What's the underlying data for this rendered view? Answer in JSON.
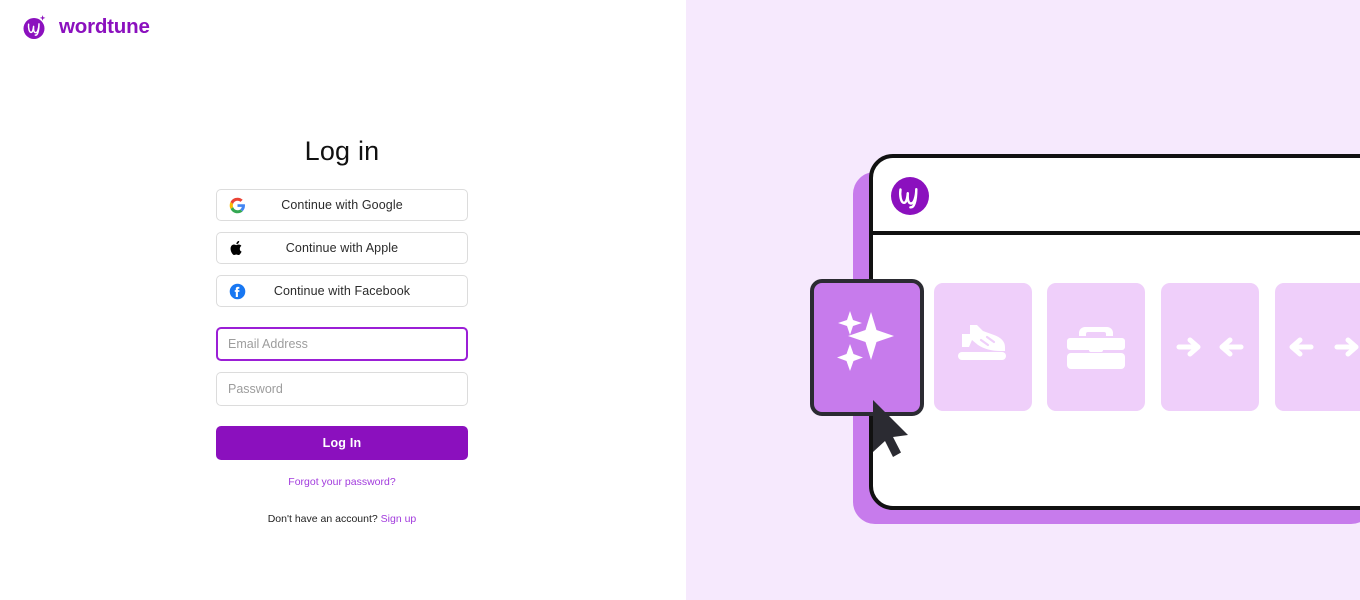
{
  "brand": {
    "name": "wordtune",
    "logo_icon": "wordtune-logo-icon",
    "color": "#8B10BE"
  },
  "login": {
    "title": "Log in",
    "social_buttons": [
      {
        "label": "Continue with Google",
        "icon": "google-icon",
        "icon_color": "#4285F4"
      },
      {
        "label": "Continue with Apple",
        "icon": "apple-icon",
        "icon_color": "#000000"
      },
      {
        "label": "Continue with Facebook",
        "icon": "facebook-icon",
        "icon_color": "#1877F2"
      }
    ],
    "email": {
      "placeholder": "Email Address",
      "value": "",
      "focused": true
    },
    "password": {
      "placeholder": "Password",
      "value": "",
      "focused": false
    },
    "submit_label": "Log In",
    "forgot_password_label": "Forgot your password?",
    "signup_prompt": "Don't have an account?",
    "signup_label": "Sign up"
  },
  "illustration": {
    "background_color": "#F6E9FD",
    "window_logo_icon": "wordtune-circle-logo-icon",
    "cursor_icon": "cursor-arrow-icon",
    "cards": [
      {
        "icon": "sparkles-icon",
        "state": "selected",
        "fill": "#C77BEC"
      },
      {
        "icon": "sneaker-icon",
        "state": "default",
        "fill": "#EFCFFA"
      },
      {
        "icon": "briefcase-icon",
        "state": "default",
        "fill": "#EFCFFA"
      },
      {
        "icon": "arrows-inward-icon",
        "state": "default",
        "fill": "#EFCFFA"
      },
      {
        "icon": "arrows-outward-icon",
        "state": "default",
        "fill": "#EFCFFA"
      }
    ]
  },
  "colors": {
    "brand_purple": "#8B10BE",
    "link_purple": "#A23BDD",
    "focus_purple": "#9B1FD6",
    "panel_bg": "#F6E9FD",
    "card_light": "#EFCFFA",
    "card_selected": "#C77BEC",
    "outline_dark": "#2B2B32"
  }
}
